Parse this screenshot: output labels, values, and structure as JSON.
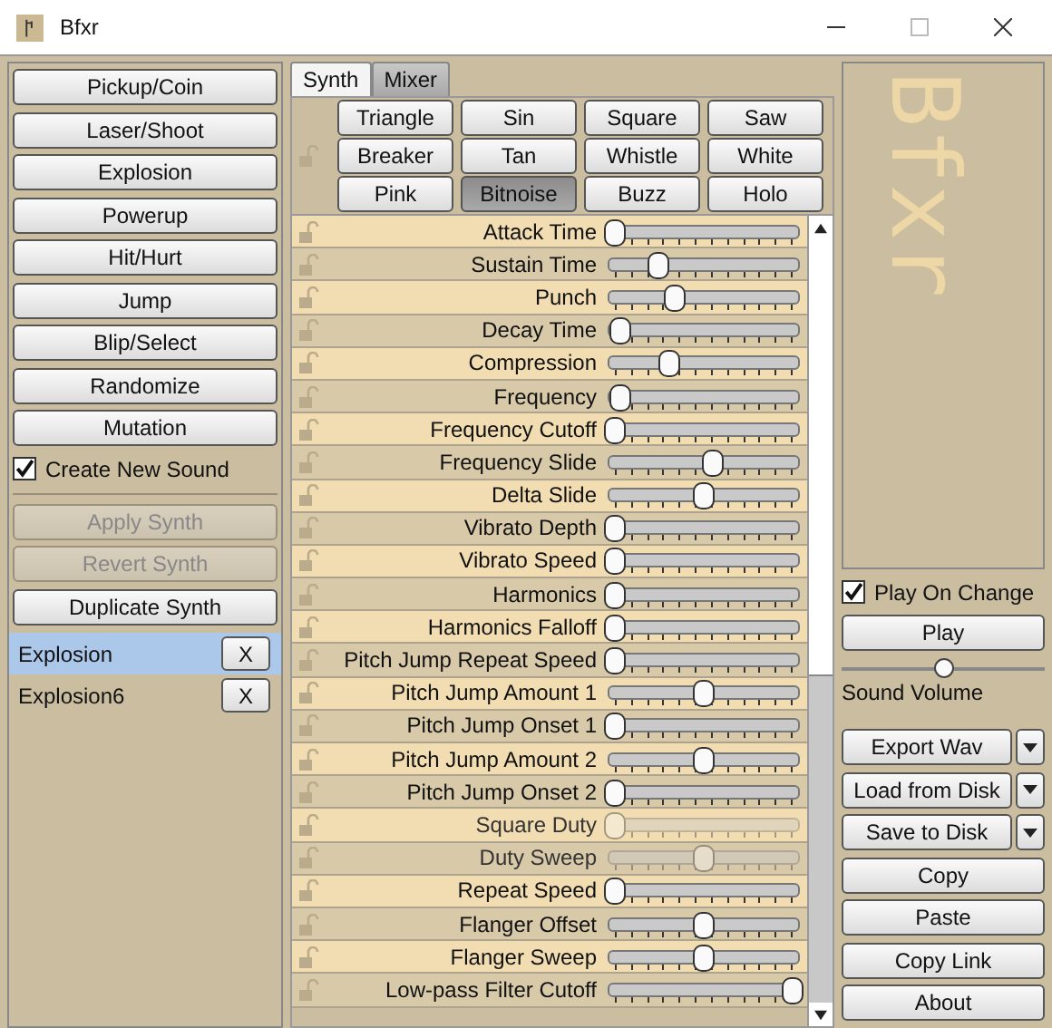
{
  "window": {
    "title": "Bfxr"
  },
  "presets": [
    "Pickup/Coin",
    "Laser/Shoot",
    "Explosion",
    "Powerup",
    "Hit/Hurt",
    "Jump",
    "Blip/Select",
    "Randomize",
    "Mutation"
  ],
  "create_new_sound": {
    "label": "Create New Sound",
    "checked": true
  },
  "synth_buttons": [
    {
      "label": "Apply Synth",
      "disabled": true
    },
    {
      "label": "Revert Synth",
      "disabled": true
    },
    {
      "label": "Duplicate Synth",
      "disabled": false
    }
  ],
  "sounds": [
    {
      "name": "Explosion",
      "selected": true,
      "remove": "X"
    },
    {
      "name": "Explosion6",
      "selected": false,
      "remove": "X"
    }
  ],
  "tabs": [
    {
      "label": "Synth",
      "selected": true
    },
    {
      "label": "Mixer",
      "selected": false
    }
  ],
  "waveforms": [
    {
      "label": "Triangle",
      "selected": false
    },
    {
      "label": "Sin",
      "selected": false
    },
    {
      "label": "Square",
      "selected": false
    },
    {
      "label": "Saw",
      "selected": false
    },
    {
      "label": "Breaker",
      "selected": false
    },
    {
      "label": "Tan",
      "selected": false
    },
    {
      "label": "Whistle",
      "selected": false
    },
    {
      "label": "White",
      "selected": false
    },
    {
      "label": "Pink",
      "selected": false
    },
    {
      "label": "Bitnoise",
      "selected": true
    },
    {
      "label": "Buzz",
      "selected": false
    },
    {
      "label": "Holo",
      "selected": false
    }
  ],
  "parameters": [
    {
      "label": "Attack Time",
      "level": 0,
      "disabled": false
    },
    {
      "label": "Sustain Time",
      "level": 0.24,
      "disabled": false
    },
    {
      "label": "Punch",
      "level": 0.34,
      "disabled": false
    },
    {
      "label": "Decay Time",
      "level": 0.03,
      "disabled": false
    },
    {
      "label": "Compression",
      "level": 0.31,
      "disabled": false
    },
    {
      "label": "Frequency",
      "level": 0.03,
      "disabled": false
    },
    {
      "label": "Frequency Cutoff",
      "level": 0,
      "disabled": false
    },
    {
      "label": "Frequency Slide",
      "level": 0.55,
      "disabled": false
    },
    {
      "label": "Delta Slide",
      "level": 0.5,
      "disabled": false
    },
    {
      "label": "Vibrato Depth",
      "level": 0,
      "disabled": false
    },
    {
      "label": "Vibrato Speed",
      "level": 0,
      "disabled": false
    },
    {
      "label": "Harmonics",
      "level": 0,
      "disabled": false
    },
    {
      "label": "Harmonics Falloff",
      "level": 0,
      "disabled": false
    },
    {
      "label": "Pitch Jump Repeat Speed",
      "level": 0,
      "disabled": false
    },
    {
      "label": "Pitch Jump Amount 1",
      "level": 0.5,
      "disabled": false
    },
    {
      "label": "Pitch Jump Onset 1",
      "level": 0,
      "disabled": false
    },
    {
      "label": "Pitch Jump Amount 2",
      "level": 0.5,
      "disabled": false
    },
    {
      "label": "Pitch Jump Onset 2",
      "level": 0,
      "disabled": false
    },
    {
      "label": "Square Duty",
      "level": 0,
      "disabled": true
    },
    {
      "label": "Duty Sweep",
      "level": 0.5,
      "disabled": true
    },
    {
      "label": "Repeat Speed",
      "level": 0,
      "disabled": false
    },
    {
      "label": "Flanger Offset",
      "level": 0.5,
      "disabled": false
    },
    {
      "label": "Flanger Sweep",
      "level": 0.5,
      "disabled": false
    },
    {
      "label": "Low-pass Filter Cutoff",
      "level": 1,
      "disabled": false
    }
  ],
  "logo": "Bfxr",
  "play_on_change": {
    "label": "Play On Change",
    "checked": true
  },
  "play_button": "Play",
  "sound_volume": {
    "label": "Sound Volume",
    "level": 0.5
  },
  "file_buttons": [
    {
      "label": "Export Wav",
      "kind": "split"
    },
    {
      "label": "Load from Disk",
      "kind": "split"
    },
    {
      "label": "Save to Disk",
      "kind": "split"
    },
    {
      "label": "Copy",
      "kind": "plain"
    },
    {
      "label": "Paste",
      "kind": "plain"
    },
    {
      "label": "Copy Link",
      "kind": "plain"
    },
    {
      "label": "About",
      "kind": "plain"
    }
  ]
}
